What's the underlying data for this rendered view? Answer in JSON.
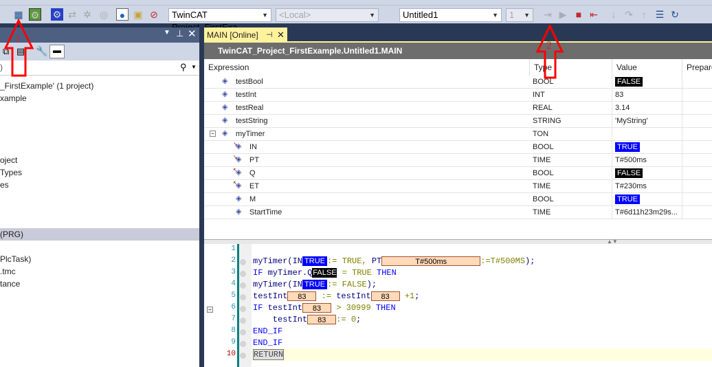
{
  "toolbar": {
    "solution_combo": "TwinCAT Project_FirstExa",
    "target_combo": "<Local>",
    "config_combo": "Untitled1",
    "task_combo": "1",
    "icons": [
      "activate-configuration-icon",
      "restart-twincat-icon",
      "plc-settings-icon",
      "refresh-icon",
      "wand-icon",
      "sync-icon",
      "target-icon",
      "folder-icon",
      "hide-icon",
      "login-icon",
      "start-icon",
      "stop-icon",
      "logout-icon",
      "step-into-icon",
      "step-over-icon",
      "step-out-icon",
      "show-next-icon",
      "reset-icon"
    ]
  },
  "left_panel": {
    "search_text": ")",
    "tree": [
      {
        "label": "_FirstExample' (1 project)",
        "selected": false
      },
      {
        "label": "xample",
        "selected": false
      },
      {
        "label": "oject",
        "selected": false
      },
      {
        "label": "Types",
        "selected": false
      },
      {
        "label": "es",
        "selected": false
      },
      {
        "label": " (PRG)",
        "selected": true
      },
      {
        "label": "PlcTask)",
        "selected": false
      },
      {
        "label": ".tmc",
        "selected": false
      },
      {
        "label": "tance",
        "selected": false
      }
    ]
  },
  "editor": {
    "tab_label": "MAIN [Online]",
    "path": "TwinCAT_Project_FirstExample.Untitled1.MAIN",
    "columns": [
      "Expression",
      "Type",
      "Value",
      "Prepare"
    ],
    "rows": [
      {
        "name": "testBool",
        "type": "BOOL",
        "value": "FALSE",
        "badge": "black",
        "level": 0
      },
      {
        "name": "testInt",
        "type": "INT",
        "value": "83",
        "level": 0
      },
      {
        "name": "testReal",
        "type": "REAL",
        "value": "3.14",
        "level": 0
      },
      {
        "name": "testString",
        "type": "STRING",
        "value": "'MyString'",
        "level": 0
      },
      {
        "name": "myTimer",
        "type": "TON",
        "value": "",
        "level": 0,
        "expanded": true
      },
      {
        "name": "IN",
        "type": "BOOL",
        "value": "TRUE",
        "badge": "blue",
        "level": 1,
        "io": "in"
      },
      {
        "name": "PT",
        "type": "TIME",
        "value": "T#500ms",
        "level": 1,
        "io": "in"
      },
      {
        "name": "Q",
        "type": "BOOL",
        "value": "FALSE",
        "badge": "black",
        "level": 1,
        "io": "out"
      },
      {
        "name": "ET",
        "type": "TIME",
        "value": "T#230ms",
        "level": 1,
        "io": "out"
      },
      {
        "name": "M",
        "type": "BOOL",
        "value": "TRUE",
        "badge": "blue",
        "level": 1
      },
      {
        "name": "StartTime",
        "type": "TIME",
        "value": "T#6d11h23m29s...",
        "level": 1
      }
    ]
  },
  "code": {
    "line_numbers": [
      "1",
      "2",
      "3",
      "4",
      "5",
      "6",
      "7",
      "8",
      "9",
      "10"
    ],
    "lines": [
      [],
      [
        [
          "id",
          "myTimer(IN"
        ],
        [
          "mb",
          "TRUE"
        ],
        [
          "lit",
          ":= TRUE, "
        ],
        [
          "id",
          "PT"
        ],
        [
          "mo",
          "T#500ms",
          144
        ],
        [
          "lit",
          ":=T#500MS"
        ],
        [
          "id",
          ");"
        ]
      ],
      [
        [
          "kw",
          "IF "
        ],
        [
          "id",
          "myTimer.Q"
        ],
        [
          "mk",
          "FALSE"
        ],
        [
          "lit",
          " = TRUE "
        ],
        [
          "kw",
          "THEN"
        ]
      ],
      [
        [
          "id",
          "myTimer(IN"
        ],
        [
          "mb",
          "TRUE"
        ],
        [
          "lit",
          ":= FALSE"
        ],
        [
          "id",
          ");"
        ]
      ],
      [
        [
          "id",
          "testInt"
        ],
        [
          "mo",
          "83",
          42
        ],
        [
          "lit",
          " := "
        ],
        [
          "id",
          "testInt"
        ],
        [
          "mo",
          "83",
          42
        ],
        [
          "lit",
          " +1"
        ],
        [
          "id",
          ";"
        ]
      ],
      [
        [
          "kw",
          "IF "
        ],
        [
          "id",
          "testInt"
        ],
        [
          "mo",
          "83",
          42
        ],
        [
          "lit",
          " > 30999 "
        ],
        [
          "kw",
          "THEN"
        ]
      ],
      [
        [
          "id",
          "    testInt"
        ],
        [
          "mo",
          "83",
          42
        ],
        [
          "lit",
          ":= 0"
        ],
        [
          "id",
          ";"
        ]
      ],
      [
        [
          "kw",
          "END_IF"
        ]
      ],
      [
        [
          "kw",
          "END_IF"
        ]
      ],
      [
        [
          "ret",
          "RETURN"
        ]
      ]
    ]
  },
  "annotations": [
    "1",
    "2"
  ],
  "colors": {
    "annotation": "#ff0000",
    "true_badge": "#0000ff",
    "false_badge": "#000000",
    "tab_active": "#fff29d",
    "monitor_box": "#ffdab9"
  }
}
